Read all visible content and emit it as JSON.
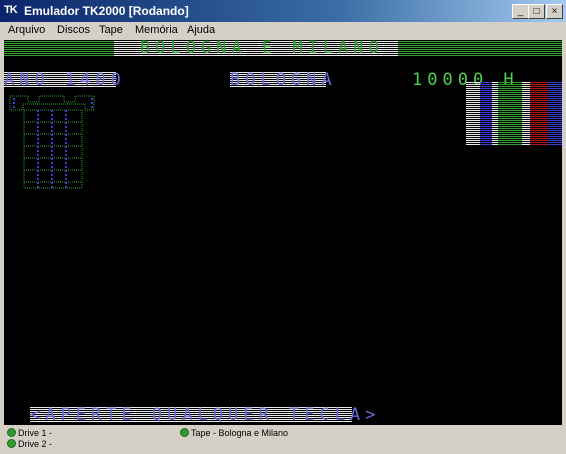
{
  "window": {
    "icon_text": "TK",
    "title": "Emulador TK2000 [Rodando]"
  },
  "controls": {
    "minimize": "_",
    "maximize": "□",
    "close": "×"
  },
  "menu": [
    "Arquivo",
    "Discos",
    "Tape",
    "Memória",
    "Ajuda"
  ],
  "screen": {
    "game_title": "BOLOGNA E MILANO",
    "year_label": "ANO 1400",
    "city": "BOLOGNA",
    "amount": "10000 H",
    "prompt": "<APERTE QUALQUER TECLA>"
  },
  "status": {
    "drive1": "Drive 1 -",
    "drive2": "Drive 2 -",
    "tape": "Tape - Bologna e Milano"
  },
  "colors": {
    "screen_bg": "#000000",
    "green": "#2fa02f",
    "bright_green": "#4fd04f",
    "blue": "#3c3cd0",
    "red": "#b01818",
    "white": "#e8e8e8",
    "led_green": "#2f9a2f"
  }
}
